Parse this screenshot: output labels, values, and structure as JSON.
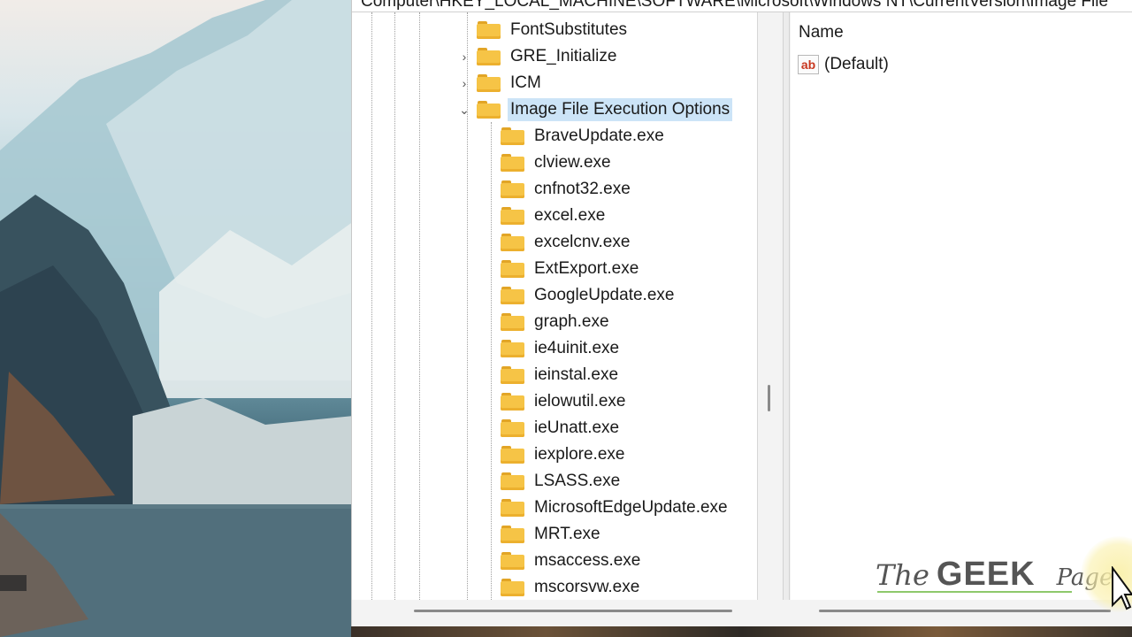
{
  "address_bar": {
    "path": "Computer\\HKEY_LOCAL_MACHINE\\SOFTWARE\\Microsoft\\Windows NT\\CurrentVersion\\Image File"
  },
  "tree": {
    "parents": [
      {
        "label": "FontSubstitutes",
        "expandable": false
      },
      {
        "label": "GRE_Initialize",
        "expandable": true
      },
      {
        "label": "ICM",
        "expandable": true
      },
      {
        "label": "Image File Execution Options",
        "expandable": true,
        "expanded": true,
        "selected": true
      }
    ],
    "children": [
      "BraveUpdate.exe",
      "clview.exe",
      "cnfnot32.exe",
      "excel.exe",
      "excelcnv.exe",
      "ExtExport.exe",
      "GoogleUpdate.exe",
      "graph.exe",
      "ie4uinit.exe",
      "ieinstal.exe",
      "ielowutil.exe",
      "ieUnatt.exe",
      "iexplore.exe",
      "LSASS.exe",
      "MicrosoftEdgeUpdate.exe",
      "MRT.exe",
      "msaccess.exe",
      "mscorsvw.exe"
    ]
  },
  "values_pane": {
    "column_header": "Name",
    "rows": [
      {
        "icon": "ab",
        "name": "(Default)"
      }
    ]
  },
  "watermark": {
    "the": "The",
    "geek": "GEEK",
    "page": "Page"
  },
  "colors": {
    "folder": "#f6c446",
    "selection": "#cce4f7",
    "ab_icon": "#c8371f"
  }
}
